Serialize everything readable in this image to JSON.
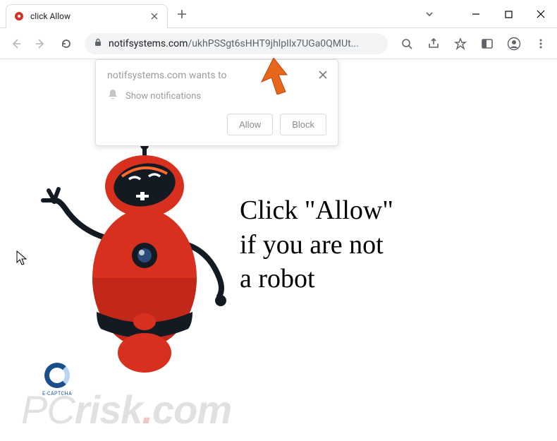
{
  "tab": {
    "title": "click Allow"
  },
  "omnibox": {
    "domain": "notifsystems.com",
    "path": "/ukhPSSgt6sHHT9jhlpIlx7UGa0QMUt..."
  },
  "prompt": {
    "header": "notifsystems.com wants to",
    "permission": "Show notifications",
    "allow": "Allow",
    "block": "Block"
  },
  "page": {
    "question": "?",
    "headline_l1": "Click \"Allow\"",
    "headline_l2": "if you are not",
    "headline_l3": "a robot",
    "captcha_label": "E-CAPTCHA"
  },
  "watermark": {
    "text": "PCrisk.com"
  }
}
